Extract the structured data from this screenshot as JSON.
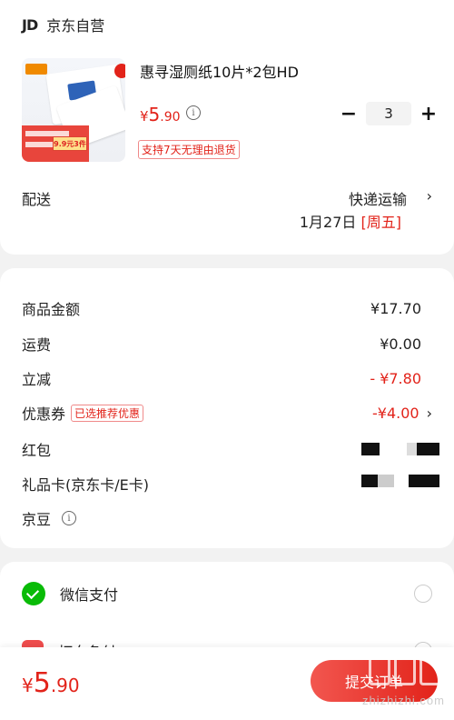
{
  "store": {
    "logo_text": "JD",
    "name": "京东自营"
  },
  "product": {
    "title": "惠寻湿厕纸10片*2包HD",
    "image_promo": "9.9元3件",
    "price": {
      "currency": "¥",
      "integer": "5",
      "decimal": ".90"
    },
    "quantity": "3",
    "minus": "−",
    "plus": "+",
    "return_tag": "支持7天无理由退货"
  },
  "delivery": {
    "label": "配送",
    "method": "快递运输",
    "date": "1月27日",
    "weekday": "[周五]"
  },
  "summary": {
    "rows": [
      {
        "label": "商品金额",
        "value": "¥17.70"
      },
      {
        "label": "运费",
        "value": "¥0.00"
      },
      {
        "label": "立减",
        "value": "- ¥7.80"
      },
      {
        "label": "优惠券",
        "tag": "已选推荐优惠",
        "value": "-¥4.00"
      },
      {
        "label": "红包"
      },
      {
        "label": "礼品卡(京东卡/E卡)"
      },
      {
        "label": "京豆"
      }
    ]
  },
  "payment": {
    "options": [
      {
        "label": "微信支付",
        "icon": "wechat-icon"
      },
      {
        "label": "打白条付",
        "icon": "baitiao-icon"
      }
    ]
  },
  "footer": {
    "total": {
      "currency": "¥",
      "integer": "5",
      "decimal": ".90"
    },
    "submit_label": "提交订单"
  },
  "watermark": {
    "text": "zhizhizhi.com"
  },
  "colors": {
    "accent": "#e2231a",
    "wechat": "#09bb07"
  }
}
